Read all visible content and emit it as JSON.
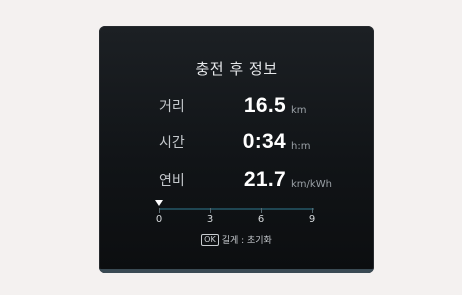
{
  "title": "충전 후 정보",
  "rows": [
    {
      "label": "거리",
      "value": "16.5",
      "unit": "km"
    },
    {
      "label": "시간",
      "value": "0:34",
      "unit": "h:m"
    },
    {
      "label": "연비",
      "value": "21.7",
      "unit": "km/kWh"
    }
  ],
  "scale": {
    "ticks": [
      "0",
      "3",
      "6",
      "9"
    ],
    "marker_value": 0
  },
  "hint": {
    "button_label": "OK",
    "text": "길게 : 초기화"
  },
  "colors": {
    "background": "#f4f1f0",
    "screen": "#111417",
    "scale_line": "#1f4652"
  }
}
